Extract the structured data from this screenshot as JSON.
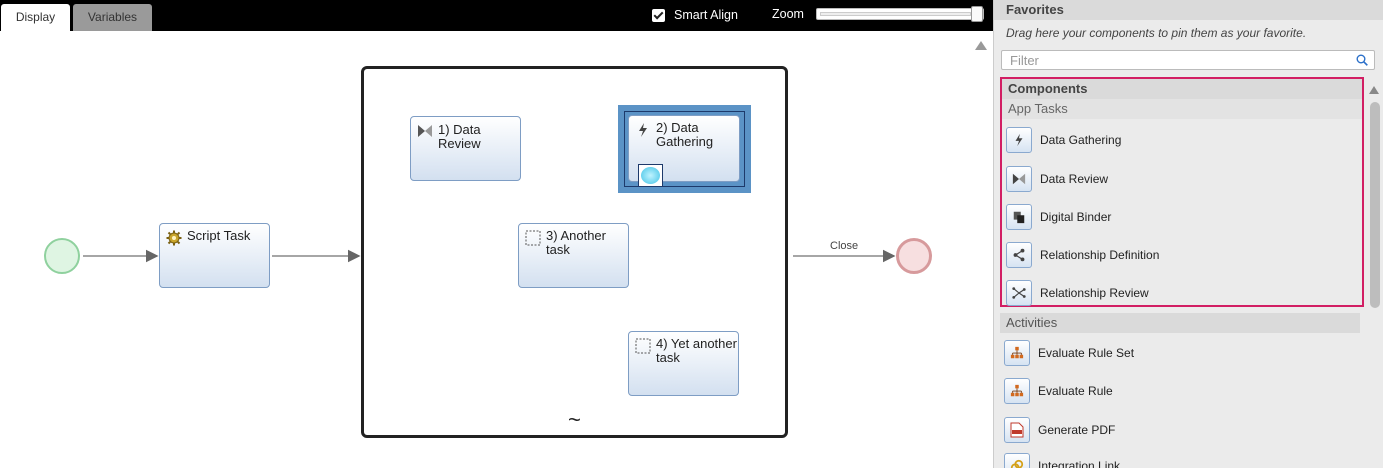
{
  "tabs": [
    {
      "label": "Display",
      "active": true
    },
    {
      "label": "Variables",
      "active": false
    }
  ],
  "toolbar": {
    "smart_align_label": "Smart Align",
    "smart_align_checked": true,
    "zoom_label": "Zoom",
    "zoom_level": 1.0
  },
  "diagram": {
    "tasks": {
      "script": "Script Task",
      "t1": "1) Data Review",
      "t2": "2) Data Gathering",
      "t3": "3) Another task",
      "t4": "4) Yet another task"
    },
    "subprocess_marker": "~",
    "close_label": "Close",
    "colors": {
      "selection": "#5b93c6",
      "task_border": "#7e9dc4",
      "start_event": "#8fd19e",
      "end_event": "#d79a9c"
    }
  },
  "panel": {
    "favorites_title": "Favorites",
    "favorites_hint": "Drag here your components to pin them as your favorite.",
    "filter_placeholder": "Filter",
    "components_title": "Components",
    "app_tasks_title": "App Tasks",
    "app_tasks": [
      {
        "label": "Data Gathering",
        "icon": "lightning-icon"
      },
      {
        "label": "Data Review",
        "icon": "bowtie-icon"
      },
      {
        "label": "Digital Binder",
        "icon": "binder-icon"
      },
      {
        "label": "Relationship Definition",
        "icon": "share-icon"
      },
      {
        "label": "Relationship Review",
        "icon": "network-icon"
      }
    ],
    "activities_title": "Activities",
    "activities": [
      {
        "label": "Evaluate Rule Set",
        "icon": "hierarchy-icon"
      },
      {
        "label": "Evaluate Rule",
        "icon": "hierarchy-icon"
      },
      {
        "label": "Generate PDF",
        "icon": "pdf-icon"
      },
      {
        "label": "Integration Link",
        "icon": "link-icon"
      }
    ],
    "highlight_color": "#d21e63"
  }
}
